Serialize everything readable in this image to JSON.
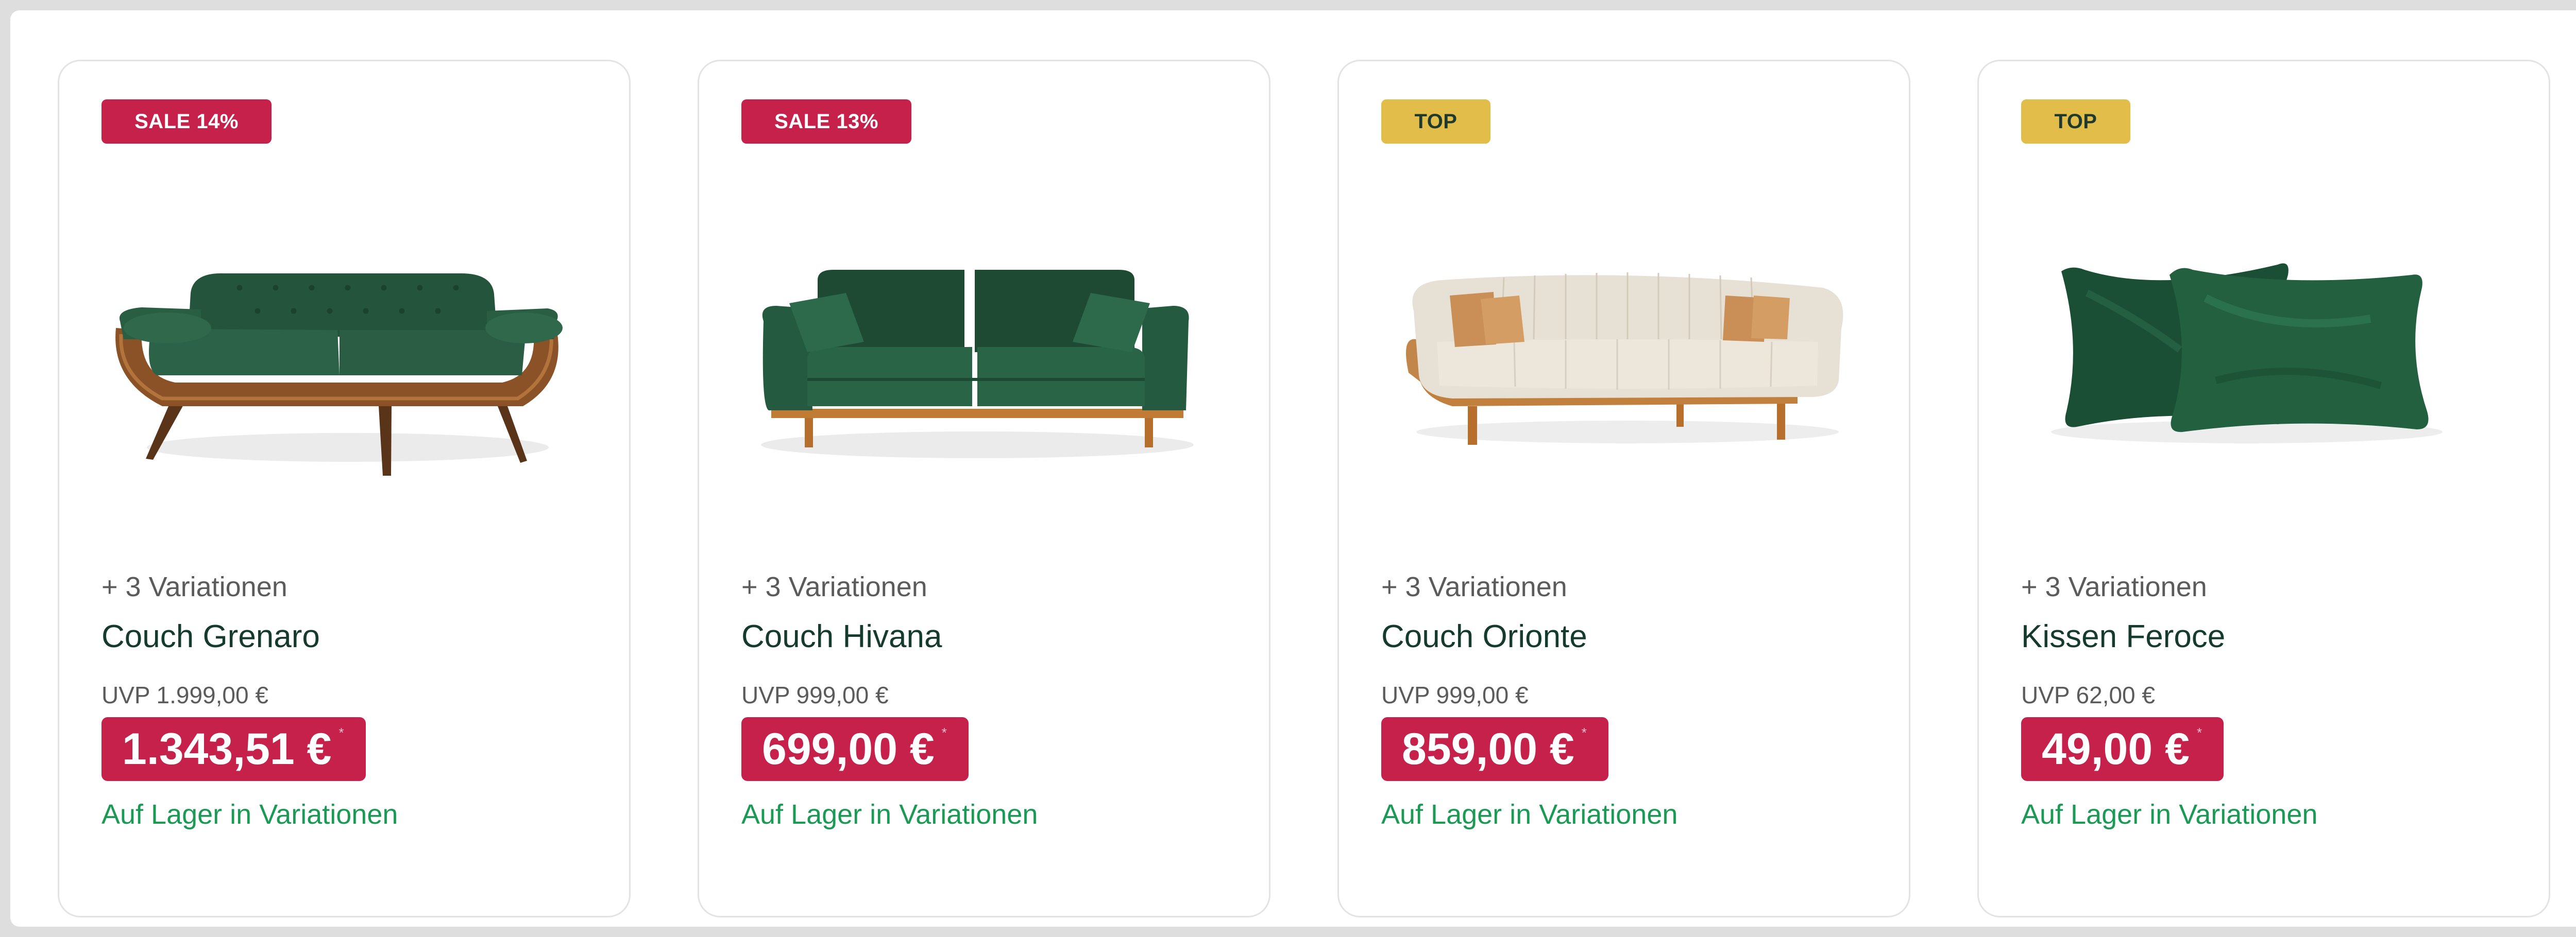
{
  "products": [
    {
      "badge": "SALE 14%",
      "badge_type": "sale",
      "image": "green-velvet-sofa-wood-frame",
      "variations": "+ 3 Variationen",
      "name": "Couch Grenaro",
      "uvp": "UVP 1.999,00 €",
      "price": "1.343,51 €",
      "price_mark": "*",
      "stock": "Auf Lager in Variationen"
    },
    {
      "badge": "SALE 13%",
      "badge_type": "sale",
      "image": "green-velvet-sofa",
      "variations": "+ 3 Variationen",
      "name": "Couch Hivana",
      "uvp": "UVP 999,00 €",
      "price": "699,00 €",
      "price_mark": "*",
      "stock": "Auf Lager in Variationen"
    },
    {
      "badge": "TOP",
      "badge_type": "top",
      "image": "cream-curved-sofa",
      "variations": "+ 3 Variationen",
      "name": "Couch Orionte",
      "uvp": "UVP 999,00 €",
      "price": "859,00 €",
      "price_mark": "*",
      "stock": "Auf Lager in Variationen"
    },
    {
      "badge": "TOP",
      "badge_type": "top",
      "image": "green-velvet-pillows",
      "variations": "+ 3 Variationen",
      "name": "Kissen Feroce",
      "uvp": "UVP 62,00 €",
      "price": "49,00 €",
      "price_mark": "*",
      "stock": "Auf Lager in Variationen"
    }
  ],
  "colors": {
    "sale_badge": "#c5214a",
    "top_badge": "#e2bd49",
    "price_bg": "#c5214a",
    "stock_text": "#1a9a55",
    "name_text": "#153a2e"
  }
}
